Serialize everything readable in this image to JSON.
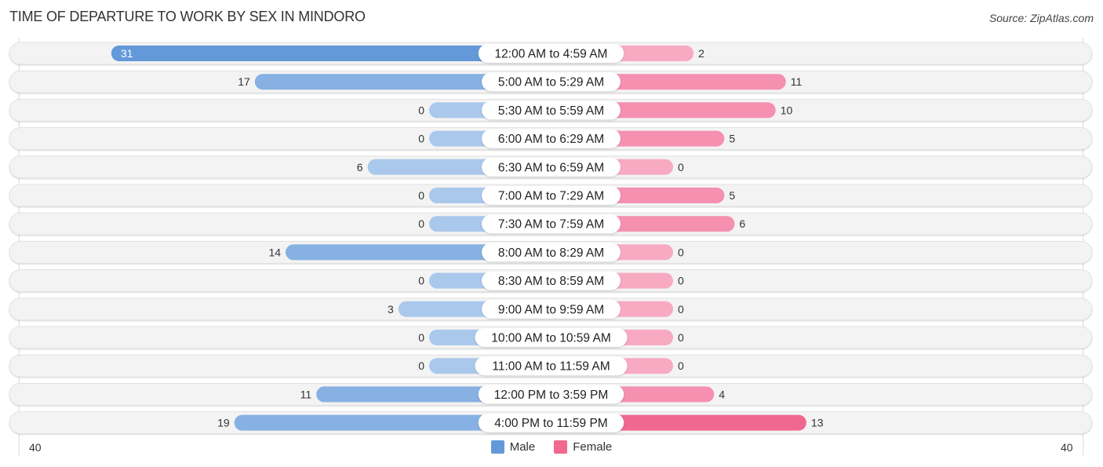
{
  "title": "TIME OF DEPARTURE TO WORK BY SEX IN MINDORO",
  "source": "Source: ZipAtlas.com",
  "legend": {
    "male_label": "Male",
    "female_label": "Female"
  },
  "colors": {
    "male_strong": "#6399d8",
    "male_mid": "#86b1e2",
    "male_light": "#aac8ec",
    "female_strong": "#f06890",
    "female_mid": "#f590b0",
    "female_light": "#f8aac3",
    "row_bg": "#f3f3f3",
    "row_border": "#dddddd"
  },
  "axis": {
    "left_label": "40",
    "right_label": "40"
  },
  "chart_data": {
    "type": "bar",
    "orientation": "horizontal-diverging",
    "title": "TIME OF DEPARTURE TO WORK BY SEX IN MINDORO",
    "xlabel": "",
    "ylabel": "",
    "xlim": [
      -40,
      40
    ],
    "legend_position": "bottom-center",
    "categories": [
      "12:00 AM to 4:59 AM",
      "5:00 AM to 5:29 AM",
      "5:30 AM to 5:59 AM",
      "6:00 AM to 6:29 AM",
      "6:30 AM to 6:59 AM",
      "7:00 AM to 7:29 AM",
      "7:30 AM to 7:59 AM",
      "8:00 AM to 8:29 AM",
      "8:30 AM to 8:59 AM",
      "9:00 AM to 9:59 AM",
      "10:00 AM to 10:59 AM",
      "11:00 AM to 11:59 AM",
      "12:00 PM to 3:59 PM",
      "4:00 PM to 11:59 PM"
    ],
    "series": [
      {
        "name": "Male",
        "values": [
          31,
          17,
          0,
          0,
          6,
          0,
          0,
          14,
          0,
          3,
          0,
          0,
          11,
          19
        ]
      },
      {
        "name": "Female",
        "values": [
          2,
          11,
          10,
          5,
          0,
          5,
          6,
          0,
          0,
          0,
          0,
          0,
          4,
          13
        ]
      }
    ]
  }
}
